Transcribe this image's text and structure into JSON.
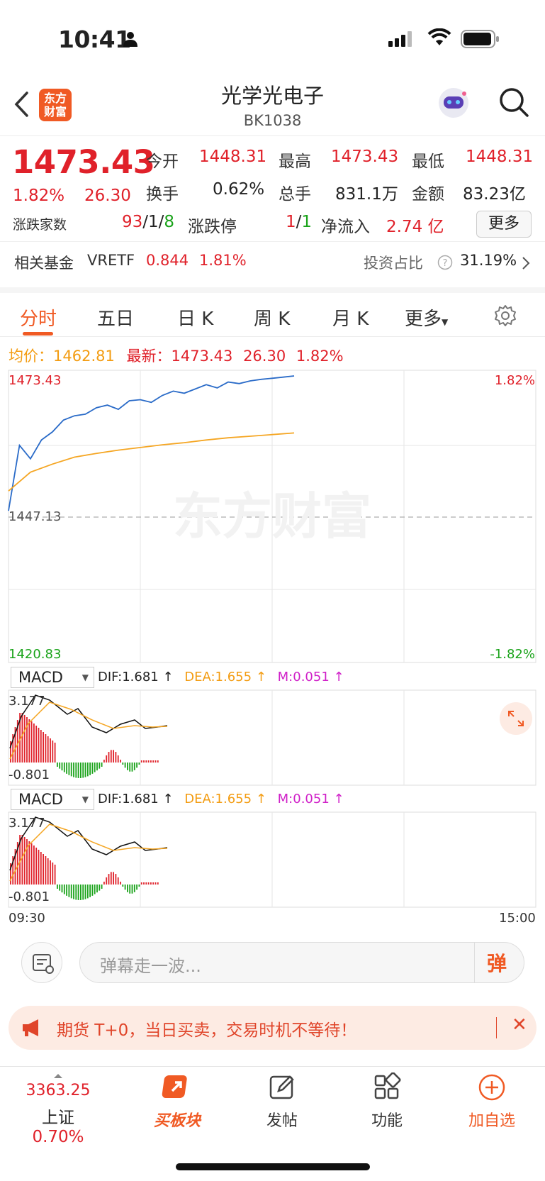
{
  "status": {
    "time": "10:41"
  },
  "header": {
    "logo_text": "东方财富",
    "title": "光学光电子",
    "code": "BK1038"
  },
  "quote": {
    "price": "1473.43",
    "change_pct": "1.82%",
    "change": "26.30",
    "open_label": "今开",
    "open": "1448.31",
    "high_label": "最高",
    "high": "1473.43",
    "low_label": "最低",
    "low": "1448.31",
    "turnover_label": "换手",
    "turnover": "0.62%",
    "volume_label": "总手",
    "volume": "831.1万",
    "amount_label": "金额",
    "amount": "83.23亿",
    "breadth_label": "涨跌家数",
    "up": "93",
    "flat": "1",
    "down": "8",
    "limit_label": "涨跌停",
    "limit_up": "1",
    "limit_down": "1",
    "netflow_label": "净流入",
    "netflow": "2.74 亿",
    "more_label": "更多",
    "fund_label": "相关基金",
    "fund_code": "VRETF",
    "fund_price": "0.844",
    "fund_pct": "1.81%",
    "weight_label": "投资占比",
    "weight": "31.19%"
  },
  "tabs": [
    "分时",
    "五日",
    "日 K",
    "周 K",
    "月 K",
    "更多"
  ],
  "legend": {
    "avg_label": "均价：",
    "avg": "1462.81",
    "latest_label": "最新：",
    "latest": "1473.43",
    "latest_chg": "26.30",
    "latest_pct": "1.82%"
  },
  "chart": {
    "y_top": "1473.43",
    "y_mid": "1447.13",
    "y_bottom": "1420.83",
    "pct_top": "1.82%",
    "pct_bottom": "-1.82%",
    "watermark": "东方财富",
    "x_start": "09:30",
    "x_end": "15:00"
  },
  "macd": [
    {
      "select": "MACD",
      "dif": "DIF:1.681 ↑",
      "dea": "DEA:1.655 ↑",
      "m": "M:0.051 ↑",
      "top": "3.177",
      "bottom": "-0.801"
    },
    {
      "select": "MACD",
      "dif": "DIF:1.681 ↑",
      "dea": "DEA:1.655 ↑",
      "m": "M:0.051 ↑",
      "top": "3.177",
      "bottom": "-0.801"
    }
  ],
  "danmu": {
    "placeholder": "弹幕走一波...",
    "button": "弹"
  },
  "promo": {
    "text": "期货 T+0，当日买卖，交易时机不等待！"
  },
  "bottom": {
    "index_value": "3363.25",
    "index_name": "上证",
    "index_pct": "0.70%",
    "items": [
      "买板块",
      "发帖",
      "功能",
      "加自选"
    ]
  },
  "chart_data": {
    "type": "line",
    "series": [
      {
        "name": "",
        "x": [
          0,
          5,
          10,
          15,
          20,
          25,
          30,
          35,
          40,
          45,
          50,
          55,
          60,
          65,
          70,
          75,
          80,
          85,
          90,
          95,
          100,
          105,
          110,
          115,
          120,
          125,
          130
        ],
        "y": [
          1448.3,
          1460.5,
          1458.0,
          1461.5,
          1463.0,
          1465.2,
          1466.0,
          1466.3,
          1467.5,
          1468.0,
          1467.2,
          1468.8,
          1469.0,
          1468.5,
          1469.8,
          1470.6,
          1470.2,
          1471.0,
          1471.8,
          1471.2,
          1472.3,
          1472.0,
          1472.5,
          1472.8,
          1473.0,
          1473.2,
          1473.43
        ]
      },
      {
        "name": "均价",
        "x": [
          0,
          10,
          20,
          30,
          40,
          50,
          60,
          70,
          80,
          90,
          100,
          110,
          120,
          130
        ],
        "y": [
          1452.0,
          1455.5,
          1457.0,
          1458.3,
          1459.0,
          1459.6,
          1460.1,
          1460.6,
          1461.0,
          1461.5,
          1461.9,
          1462.2,
          1462.5,
          1462.81
        ]
      }
    ],
    "ylim": [
      1420.83,
      1473.43
    ]
  }
}
